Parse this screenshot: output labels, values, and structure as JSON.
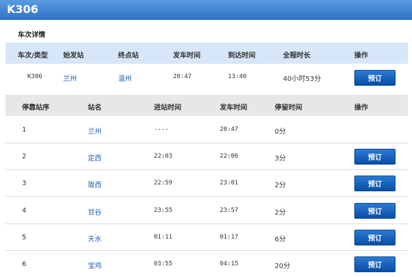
{
  "header": {
    "title": "K306"
  },
  "section": {
    "title": "车次详情"
  },
  "train_table": {
    "headers": [
      "车次/类型",
      "始发站",
      "终点站",
      "发车时间",
      "到达时间",
      "全程时长",
      "操作"
    ],
    "row": {
      "train": "K306",
      "origin": "兰州",
      "destination": "温州",
      "depart": "20:47",
      "arrive": "13:40",
      "duration": "40小时53分",
      "action": "预订"
    }
  },
  "stops_table": {
    "headers": [
      "停靠站序",
      "站名",
      "进站时间",
      "发车时间",
      "停留时间",
      "操作"
    ],
    "rows": [
      {
        "seq": "1",
        "station": "兰州",
        "arrive": "----",
        "depart": "20:47",
        "stay": "0分",
        "action": ""
      },
      {
        "seq": "2",
        "station": "定西",
        "arrive": "22:03",
        "depart": "22:06",
        "stay": "3分",
        "action": "预订"
      },
      {
        "seq": "3",
        "station": "陇西",
        "arrive": "22:59",
        "depart": "23:01",
        "stay": "2分",
        "action": "预订"
      },
      {
        "seq": "4",
        "station": "甘谷",
        "arrive": "23:55",
        "depart": "23:57",
        "stay": "2分",
        "action": "预订"
      },
      {
        "seq": "5",
        "station": "天水",
        "arrive": "01:11",
        "depart": "01:17",
        "stay": "6分",
        "action": "预订"
      },
      {
        "seq": "6",
        "station": "宝鸡",
        "arrive": "03:55",
        "depart": "04:15",
        "stay": "20分",
        "action": "预订"
      }
    ]
  }
}
